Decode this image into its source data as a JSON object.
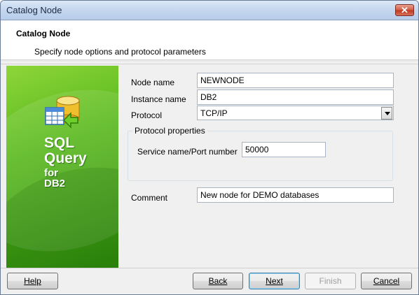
{
  "window": {
    "title": "Catalog Node"
  },
  "header": {
    "title": "Catalog Node",
    "subtitle": "Specify node options and protocol parameters"
  },
  "banner": {
    "line1": "SQL",
    "line2": "Query",
    "line3": "for",
    "line4": "DB2",
    "icon": "database-arrow-icon"
  },
  "form": {
    "node_name_label": "Node name",
    "node_name_value": "NEWNODE",
    "instance_name_label": "Instance name",
    "instance_name_value": "DB2",
    "protocol_label": "Protocol",
    "protocol_value": "TCP/IP",
    "protocol_group_title": "Protocol properties",
    "service_label": "Service name/Port number",
    "service_value": "50000",
    "comment_label": "Comment",
    "comment_value": "New node for DEMO databases"
  },
  "footer": {
    "help_label": "Help",
    "back_label": "Back",
    "next_label": "Next",
    "finish_label": "Finish",
    "cancel_label": "Cancel"
  },
  "colors": {
    "banner_green": "#4fae18",
    "title_bar": "#c4d7ef",
    "close_red": "#c03b22"
  }
}
